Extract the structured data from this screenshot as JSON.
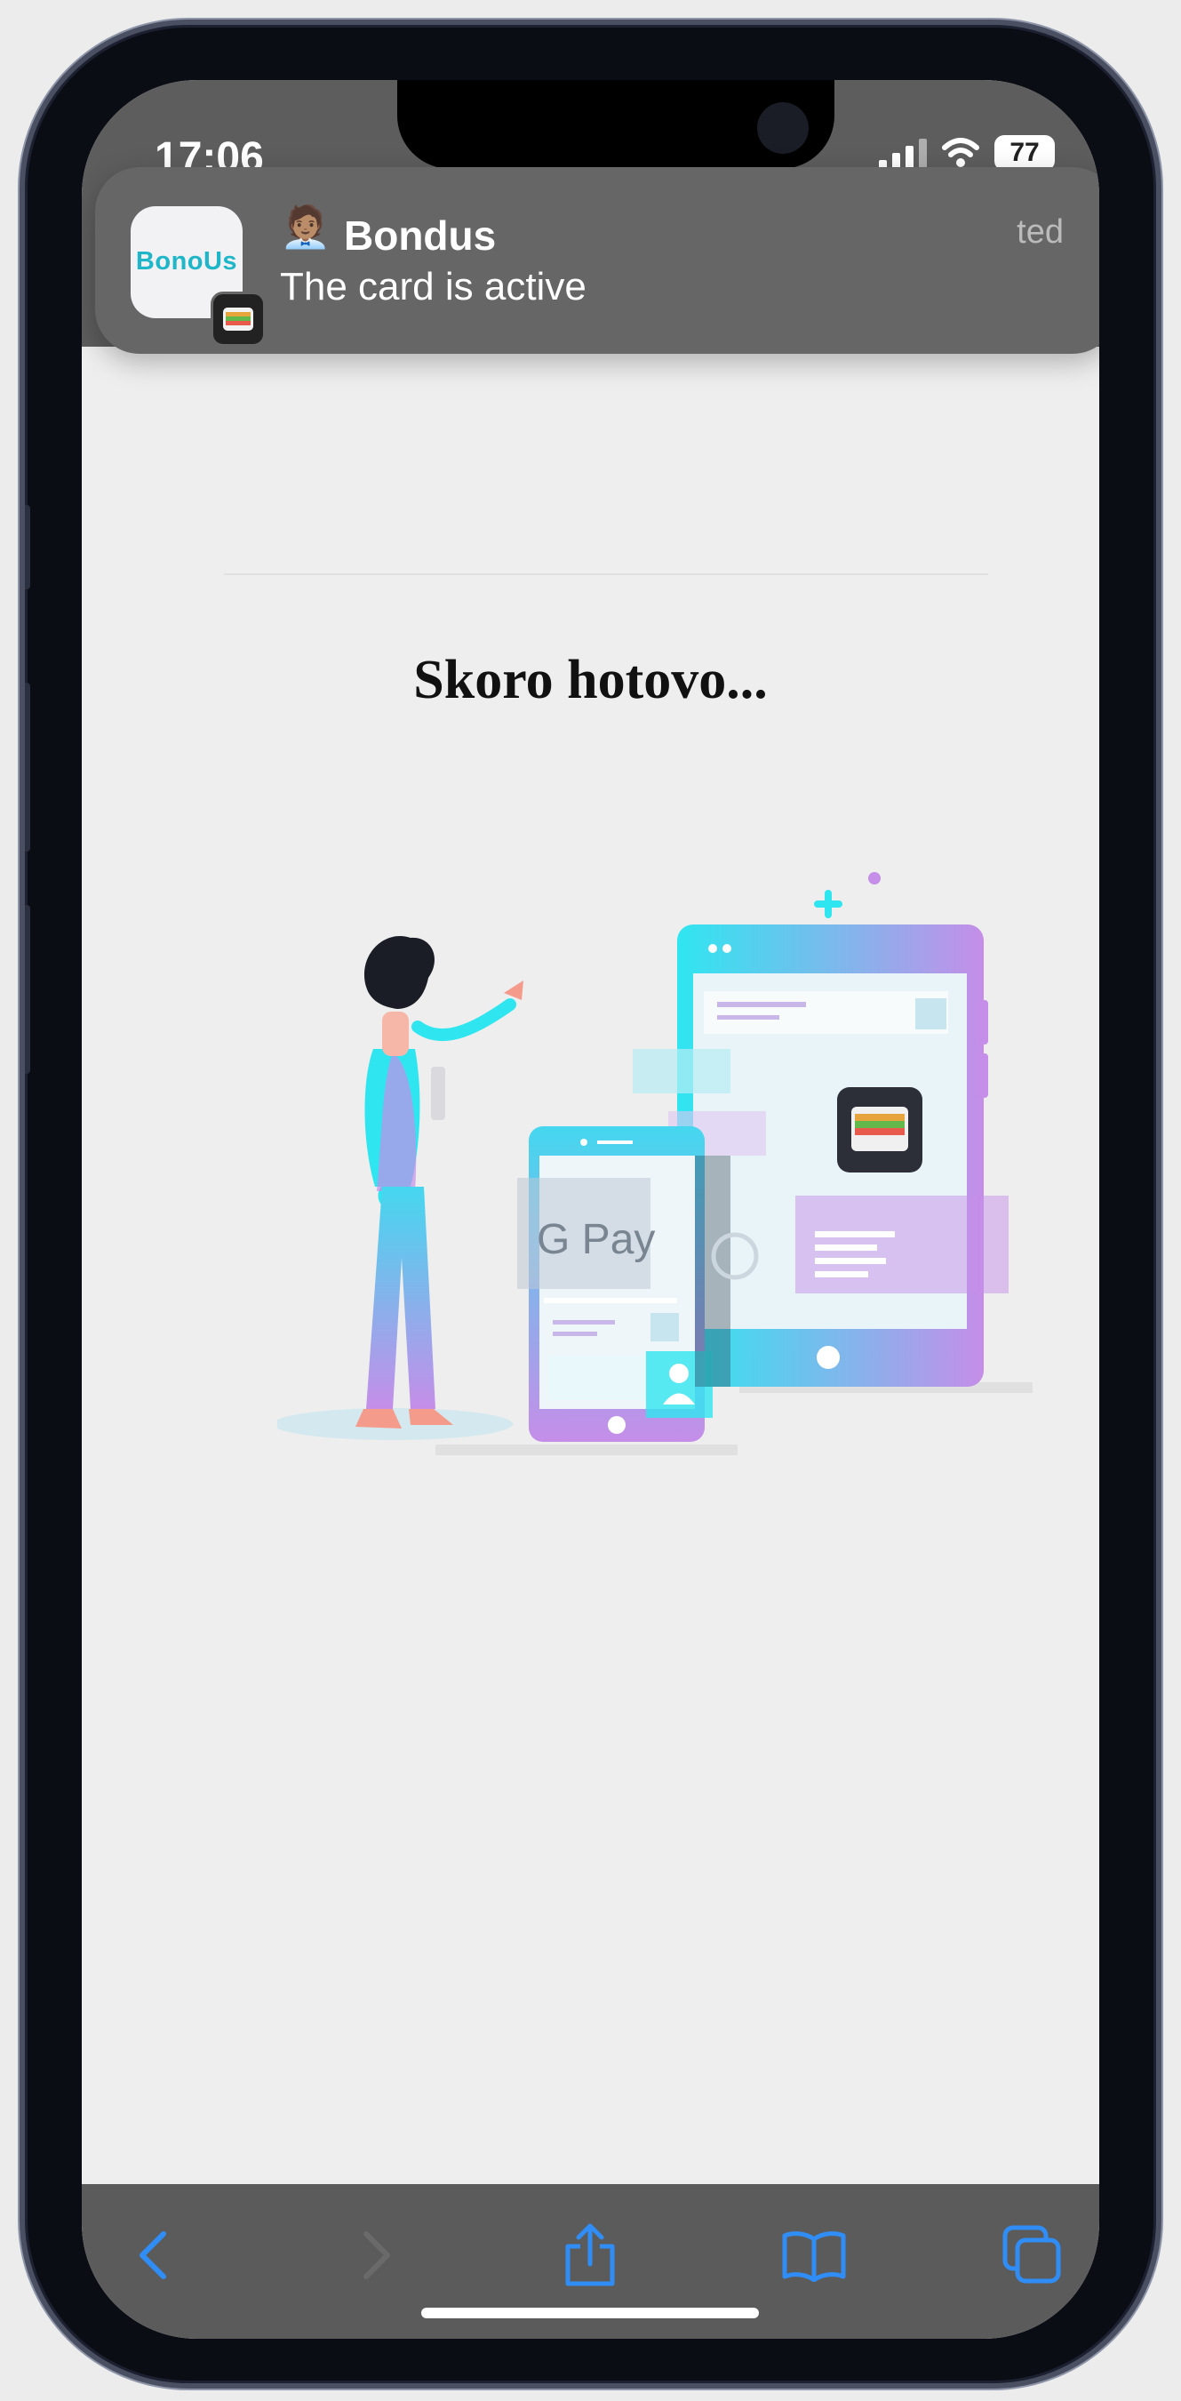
{
  "status": {
    "time": "17:06",
    "battery": "77"
  },
  "notification": {
    "app_name": "Bondus",
    "app_logo_text": "BonoUs",
    "message": "The card is active",
    "time": "ted"
  },
  "page": {
    "heading": "Skoro hotovo...",
    "gpay_label": "G Pay"
  },
  "toolbar": {
    "items": [
      "back-icon",
      "forward-icon",
      "share-icon",
      "bookmarks-icon",
      "tabs-icon"
    ]
  },
  "colors": {
    "accent": "#2f8df5",
    "cyan": "#2fe6f0",
    "violet": "#c58ee8"
  }
}
